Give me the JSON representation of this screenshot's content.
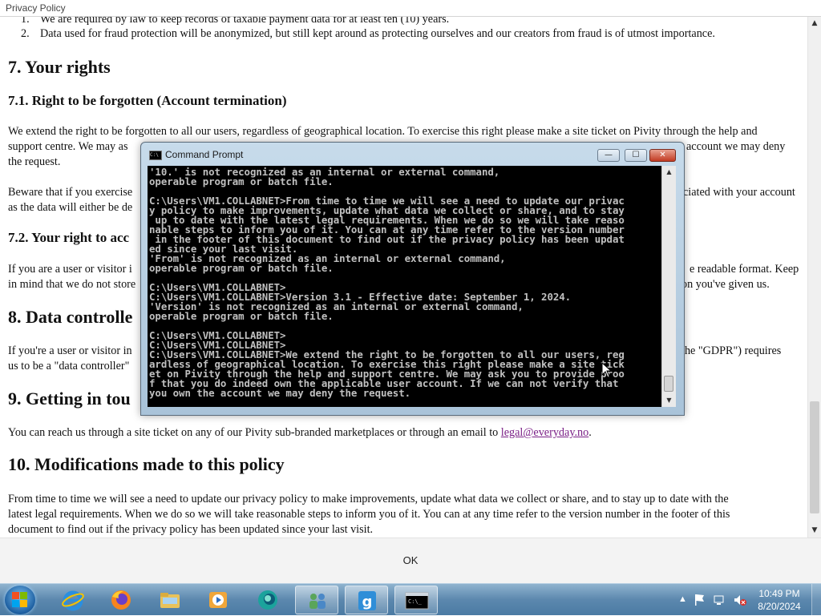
{
  "dialog": {
    "title": "Privacy Policy",
    "ok_label": "OK"
  },
  "document": {
    "list_item_1_num": "1.",
    "list_item_1": "We are required by law to keep records of taxable payment data for at least ten (10) years.",
    "list_item_2_num": "2.",
    "list_item_2": "Data used for fraud protection will be anonymized, but still kept around as protecting ourselves and our creators from fraud is of utmost importance.",
    "h_your_rights": "7. Your rights",
    "h_71": "7.1. Right to be forgotten (Account termination)",
    "p_71a_line1": "We extend the right to be forgotten to all our users, regardless of geographical location. To exercise this right please make a site ticket on Pivity through the help and",
    "p_71a_line2_left": "support centre. We may as",
    "p_71a_line2_right": "account we may deny",
    "p_71a_line3": "the request.",
    "p_71b_line1_left": "Beware that if you exercise",
    "p_71b_line1_right": "ciated with your account",
    "p_71b_line2_left": "as the data will either be de",
    "h_72_left": "7.2. Your right to acc",
    "p_72_line1_left": "If you are a user or visitor i",
    "p_72_line1_right": "e readable format. Keep",
    "p_72_line2_left": "in mind that we do not store",
    "p_72_line2_right": "on you've given us.",
    "h_8_left": "8. Data controlle",
    "p_8_line1_left": "If you're a user or visitor in",
    "p_8_line1_right": "the \"GDPR\") requires",
    "p_8_line2_left": "us to be a \"data controller\"",
    "h_9_left": "9. Getting in tou",
    "p_9_text": "You can reach us through a site ticket on any of our Pivity sub-branded marketplaces or through an email to",
    "p_9_email": "legal@everyday.no",
    "p_9_end": ".",
    "h_10": "10. Modifications made to this policy",
    "p_10_line1": "From time to time we will see a need to update our privacy policy to make improvements, update what data we collect or share, and to stay up to date with the",
    "p_10_line2": "latest legal requirements. When we do so we will take reasonable steps to inform you of it. You can at any time refer to the version number in the footer of this",
    "p_10_line3": "document to find out if the privacy policy has been updated since your last visit."
  },
  "cmd_window": {
    "title": "Command Prompt",
    "console_text": "'10.' is not recognized as an internal or external command,\noperable program or batch file.\n\nC:\\Users\\VM1.COLLABNET>From time to time we will see a need to update our privac\ny policy to make improvements, update what data we collect or share, and to stay\n up to date with the latest legal requirements. When we do so we will take reaso\nnable steps to inform you of it. You can at any time refer to the version number\n in the footer of this document to find out if the privacy policy has been updat\ned since your last visit.\n'From' is not recognized as an internal or external command,\noperable program or batch file.\n\nC:\\Users\\VM1.COLLABNET>\nC:\\Users\\VM1.COLLABNET>Version 3.1 - Effective date: September 1, 2024.\n'Version' is not recognized as an internal or external command,\noperable program or batch file.\n\nC:\\Users\\VM1.COLLABNET>\nC:\\Users\\VM1.COLLABNET>\nC:\\Users\\VM1.COLLABNET>We extend the right to be forgotten to all our users, reg\nardless of geographical location. To exercise this right please make a site tick\net on Pivity through the help and support centre. We may ask you to provide proo\nf that you do indeed own the applicable user account. If we can not verify that\nyou own the account we may deny the request.",
    "minimize_glyph": "—",
    "maximize_glyph": "☐",
    "close_glyph": "✕"
  },
  "taskbar": {
    "items": [
      "start-button",
      "internet-explorer",
      "firefox",
      "file-explorer",
      "media-player",
      "chat-app",
      "control-panel",
      "g-app",
      "command-prompt"
    ],
    "clock_time": "10:49 PM",
    "clock_date": "8/20/2024"
  },
  "colors": {
    "link": "#7a1f86",
    "console_bg": "#000000",
    "console_fg": "#c0c0c0"
  }
}
